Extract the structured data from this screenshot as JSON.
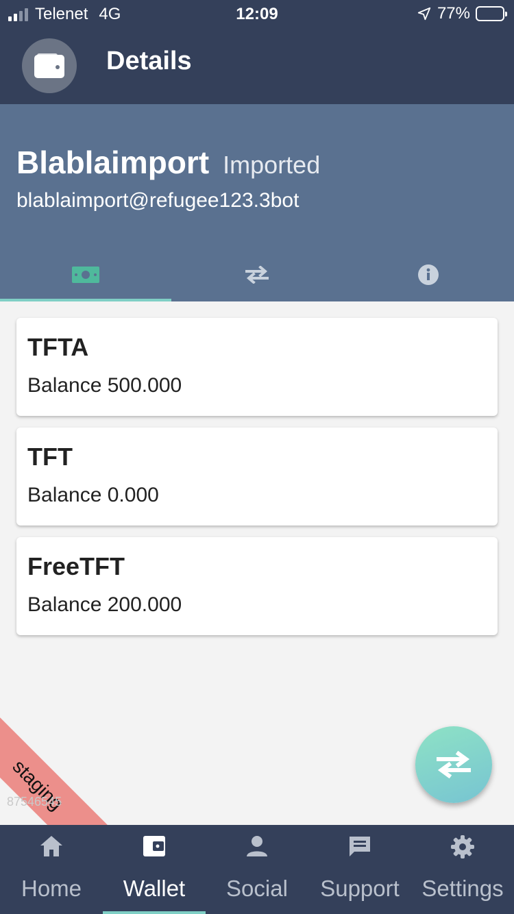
{
  "status_bar": {
    "carrier": "Telenet",
    "network": "4G",
    "time": "12:09",
    "battery_percent": "77%",
    "battery_level": 0.77,
    "icons": [
      "signal-bars-icon",
      "location-arrow-icon",
      "battery-icon"
    ]
  },
  "app_bar": {
    "title": "Details",
    "icon": "wallet-icon"
  },
  "wallet": {
    "name": "Blablaimport",
    "type": "Imported",
    "address": "blablaimport@refugee123.3bot"
  },
  "tabs": [
    {
      "icon": "money-icon",
      "active": true
    },
    {
      "icon": "transfer-icon",
      "active": false
    },
    {
      "icon": "info-icon",
      "active": false
    }
  ],
  "balances": [
    {
      "coin": "TFTA",
      "label": "Balance 500.000"
    },
    {
      "coin": "TFT",
      "label": "Balance 0.000"
    },
    {
      "coin": "FreeTFT",
      "label": "Balance 200.000"
    }
  ],
  "environment": {
    "ribbon": "staging",
    "build": "87546545"
  },
  "fab": {
    "icon": "transfer-icon"
  },
  "bottom_nav": {
    "items": [
      {
        "label": "Home",
        "icon": "home-icon",
        "active": false
      },
      {
        "label": "Wallet",
        "icon": "wallet-icon",
        "active": true
      },
      {
        "label": "Social",
        "icon": "person-icon",
        "active": false
      },
      {
        "label": "Support",
        "icon": "chat-icon",
        "active": false
      },
      {
        "label": "Settings",
        "icon": "gear-icon",
        "active": false
      }
    ]
  },
  "colors": {
    "app_bar": "#34405a",
    "header": "#5a7190",
    "accent": "#7fcfc5",
    "money_icon": "#4fb99c",
    "ribbon": "#ec8f8b",
    "background": "#f3f3f3"
  }
}
